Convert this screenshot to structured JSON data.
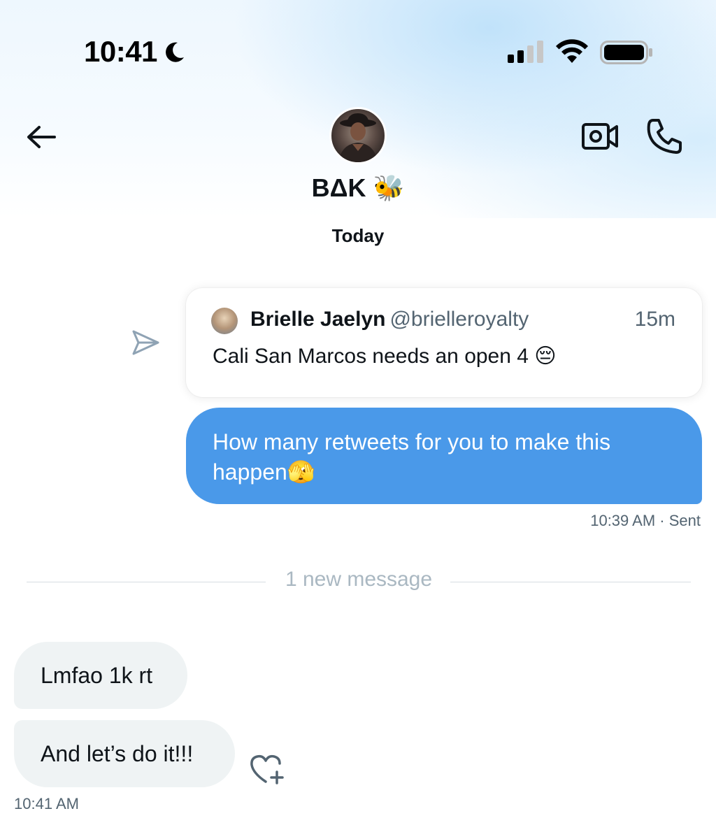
{
  "status_bar": {
    "time": "10:41"
  },
  "header": {
    "contact_name": "BΔK 🐝"
  },
  "conversation": {
    "date_label": "Today",
    "shared_tweet": {
      "author": "Brielle Jaelyn",
      "handle": "@brielleroyalty",
      "age": "15m",
      "text": "Cali San Marcos needs an open 4 😔"
    },
    "outgoing_message": {
      "text": "How many retweets for you to make this happen🫣",
      "time": "10:39 AM",
      "status": "Sent"
    },
    "new_message_label": "1 new message",
    "incoming_messages": [
      {
        "text": "Lmfao 1k rt"
      },
      {
        "text": "And let’s do it!!!"
      }
    ],
    "incoming_time": "10:41 AM"
  },
  "colors": {
    "accent_bubble": "#4a99e9",
    "incoming_bubble": "#eff3f4",
    "muted_text": "#536471"
  }
}
